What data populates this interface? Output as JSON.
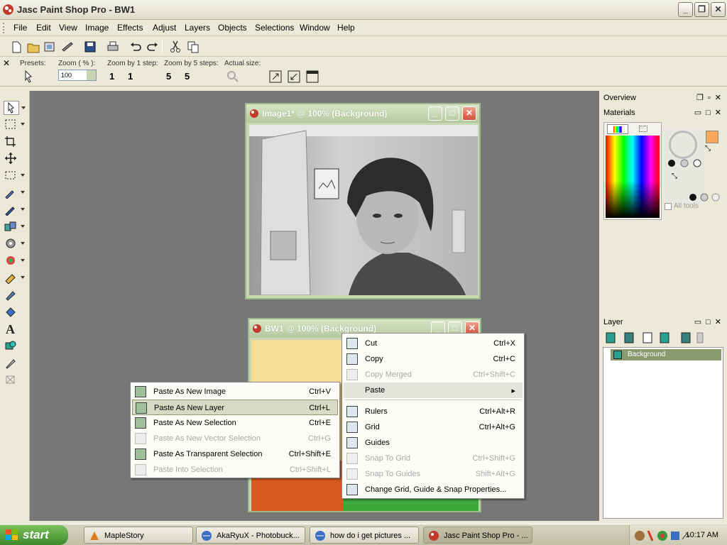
{
  "app": {
    "title": "Jasc Paint Shop Pro - BW1",
    "controls": {
      "minimize": "_",
      "maximize": "❐",
      "close": "✕"
    }
  },
  "menubar": [
    "File",
    "Edit",
    "View",
    "Image",
    "Effects",
    "Adjust",
    "Layers",
    "Objects",
    "Selections",
    "Window",
    "Help"
  ],
  "options": {
    "presets_label": "Presets:",
    "zoom_label": "Zoom ( % ):",
    "zoom_value": "100",
    "zoom1_label": "Zoom by 1 step:",
    "zoom1_in": "1",
    "zoom1_out": "1",
    "zoom5_label": "Zoom by 5 steps:",
    "zoom5_in": "5",
    "zoom5_out": "5",
    "actual_label": "Actual size:"
  },
  "windows": {
    "image1_title": "Image1* @ 100% (Background)",
    "bw1_title": "BW1 @ 100% (Background)"
  },
  "panels": {
    "overview_title": "Overview",
    "materials_title": "Materials",
    "all_tools_label": "All tools",
    "layer_title": "Layer",
    "layer_name": "Background",
    "colors": {
      "foreground": "#f9a85a",
      "layer_selected": "#8a9a6f"
    }
  },
  "edit_menu": [
    {
      "label": "Cut",
      "shortcut": "Ctrl+X",
      "disabled": false,
      "icon": "scissors-icon"
    },
    {
      "label": "Copy",
      "shortcut": "Ctrl+C",
      "disabled": false,
      "icon": "copy-icon"
    },
    {
      "label": "Copy Merged",
      "shortcut": "Ctrl+Shift+C",
      "disabled": true,
      "icon": "copy-merged-icon"
    },
    {
      "label": "Paste",
      "shortcut": "",
      "disabled": false,
      "submenu": true
    },
    {
      "label": "Rulers",
      "shortcut": "Ctrl+Alt+R",
      "disabled": false,
      "icon": "rulers-icon"
    },
    {
      "label": "Grid",
      "shortcut": "Ctrl+Alt+G",
      "disabled": false,
      "icon": "grid-icon"
    },
    {
      "label": "Guides",
      "shortcut": "",
      "disabled": false,
      "icon": "guides-icon"
    },
    {
      "label": "Snap To Grid",
      "shortcut": "Ctrl+Shift+G",
      "disabled": true,
      "icon": "snap-grid-icon"
    },
    {
      "label": "Snap To Guides",
      "shortcut": "Shift+Alt+G",
      "disabled": true,
      "icon": "snap-guides-icon"
    },
    {
      "label": "Change Grid, Guide & Snap Properties...",
      "shortcut": "",
      "disabled": false,
      "icon": "grid-properties-icon"
    }
  ],
  "paste_menu": [
    {
      "label": "Paste As New Image",
      "shortcut": "Ctrl+V",
      "disabled": false
    },
    {
      "label": "Paste As New Layer",
      "shortcut": "Ctrl+L",
      "disabled": false,
      "highlighted": true
    },
    {
      "label": "Paste As New Selection",
      "shortcut": "Ctrl+E",
      "disabled": false
    },
    {
      "label": "Paste As New Vector Selection",
      "shortcut": "Ctrl+G",
      "disabled": true
    },
    {
      "label": "Paste As Transparent Selection",
      "shortcut": "Ctrl+Shift+E",
      "disabled": false
    },
    {
      "label": "Paste Into Selection",
      "shortcut": "Ctrl+Shift+L",
      "disabled": true
    }
  ],
  "taskbar": {
    "start_label": "start",
    "tasks": [
      {
        "label": "MapleStory",
        "active": false
      },
      {
        "label": "AkaRyuX - Photobuck...",
        "active": false
      },
      {
        "label": "how do i get pictures ...",
        "active": false
      },
      {
        "label": "Jasc Paint Shop Pro - ...",
        "active": true
      }
    ],
    "clock": "10:17 AM"
  }
}
